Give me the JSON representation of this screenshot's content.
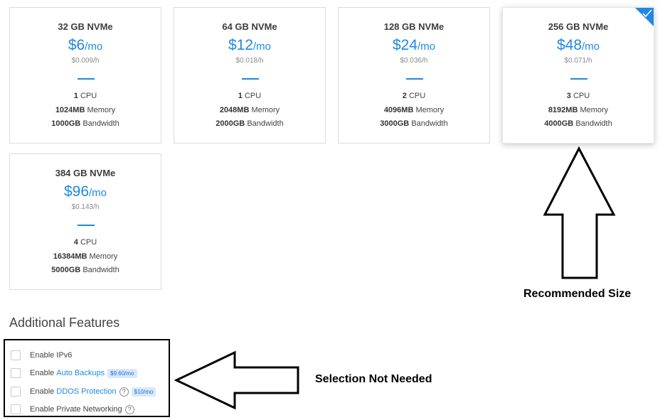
{
  "plans": [
    {
      "name": "32 GB NVMe",
      "price": "$6",
      "period": "/mo",
      "hourly": "$0.009/h",
      "cpu": "1",
      "cpu_label": " CPU",
      "memory": "1024MB",
      "memory_label": " Memory",
      "bandwidth": "1000GB",
      "bandwidth_label": " Bandwidth"
    },
    {
      "name": "64 GB NVMe",
      "price": "$12",
      "period": "/mo",
      "hourly": "$0.018/h",
      "cpu": "1",
      "cpu_label": " CPU",
      "memory": "2048MB",
      "memory_label": " Memory",
      "bandwidth": "2000GB",
      "bandwidth_label": " Bandwidth"
    },
    {
      "name": "128 GB NVMe",
      "price": "$24",
      "period": "/mo",
      "hourly": "$0.036/h",
      "cpu": "2",
      "cpu_label": " CPU",
      "memory": "4096MB",
      "memory_label": " Memory",
      "bandwidth": "3000GB",
      "bandwidth_label": " Bandwidth"
    },
    {
      "name": "256 GB NVMe",
      "price": "$48",
      "period": "/mo",
      "hourly": "$0.071/h",
      "cpu": "3",
      "cpu_label": " CPU",
      "memory": "8192MB",
      "memory_label": " Memory",
      "bandwidth": "4000GB",
      "bandwidth_label": " Bandwidth",
      "selected": true
    },
    {
      "name": "384 GB NVMe",
      "price": "$96",
      "period": "/mo",
      "hourly": "$0.143/h",
      "cpu": "4",
      "cpu_label": " CPU",
      "memory": "16384MB",
      "memory_label": " Memory",
      "bandwidth": "5000GB",
      "bandwidth_label": " Bandwidth"
    }
  ],
  "features": {
    "title": "Additional Features",
    "ipv6": {
      "prefix": "Enable IPv6"
    },
    "backups": {
      "prefix": "Enable",
      "link": "Auto Backups",
      "price": "$9.60/mo"
    },
    "ddos": {
      "prefix": "Enable",
      "link": "DDOS Protection",
      "help_icon": "?",
      "price": "$10/mo"
    },
    "private": {
      "prefix": "Enable Private Networking",
      "help_icon": "?"
    }
  },
  "annotations": {
    "recommended": "Recommended Size",
    "not_needed": "Selection Not Needed"
  },
  "colors": {
    "accent": "#1e88e5"
  }
}
